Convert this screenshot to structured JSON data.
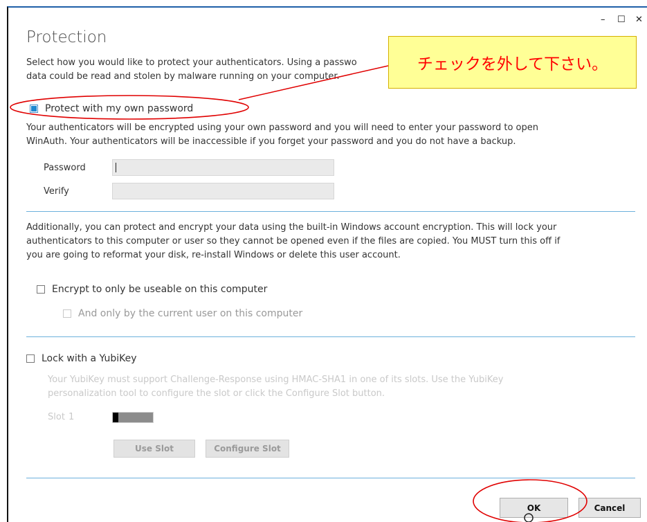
{
  "window": {
    "title": "Protection",
    "controls": {
      "minimize": "–",
      "maximize": "☐",
      "close": "✕"
    }
  },
  "intro": {
    "line1": "Select how you would like to protect your authenticators. Using a passwo",
    "line2": "data could be read and stolen by malware running on your computer."
  },
  "password_section": {
    "checkbox_label": "Protect with my own password",
    "checked": true,
    "description_line1": "Your authenticators will be encrypted using your own password and you will need to enter your password to open",
    "description_line2": "WinAuth. Your authenticators will be inaccessible if you forget your password and you do not have a backup.",
    "password_label": "Password",
    "verify_label": "Verify",
    "password_value": "",
    "verify_value": ""
  },
  "windows_section": {
    "description_line1": "Additionally, you can protect and encrypt your data using the built-in Windows account encryption. This will lock your",
    "description_line2": "authenticators to this computer or user so they cannot be opened even if the files are copied. You MUST turn this off if",
    "description_line3": "you are going to reformat your disk, re-install Windows or delete this user account.",
    "encrypt_label": "Encrypt to only be useable on this computer",
    "encrypt_checked": false,
    "user_label": "And only by the current user on this computer",
    "user_checked": false
  },
  "yubikey_section": {
    "lock_label": "Lock with a YubiKey",
    "lock_checked": false,
    "description_line1": "Your YubiKey must support Challenge-Response using HMAC-SHA1 in one of its slots. Use the YubiKey",
    "description_line2": "personalization tool to configure the slot or click the Configure Slot button.",
    "slot_label": "Slot",
    "slot_value": "1",
    "use_slot_label": "Use Slot",
    "configure_slot_label": "Configure Slot"
  },
  "footer": {
    "ok_label": "OK",
    "cancel_label": "Cancel"
  },
  "annotation": {
    "callout_text": "チェックを外して下さい。",
    "callout_bg": "#ffff96",
    "callout_text_color": "#ff0000",
    "circle_color": "#e00000"
  },
  "colors": {
    "accent": "#1e88d0",
    "separator": "#6cb0dc"
  }
}
